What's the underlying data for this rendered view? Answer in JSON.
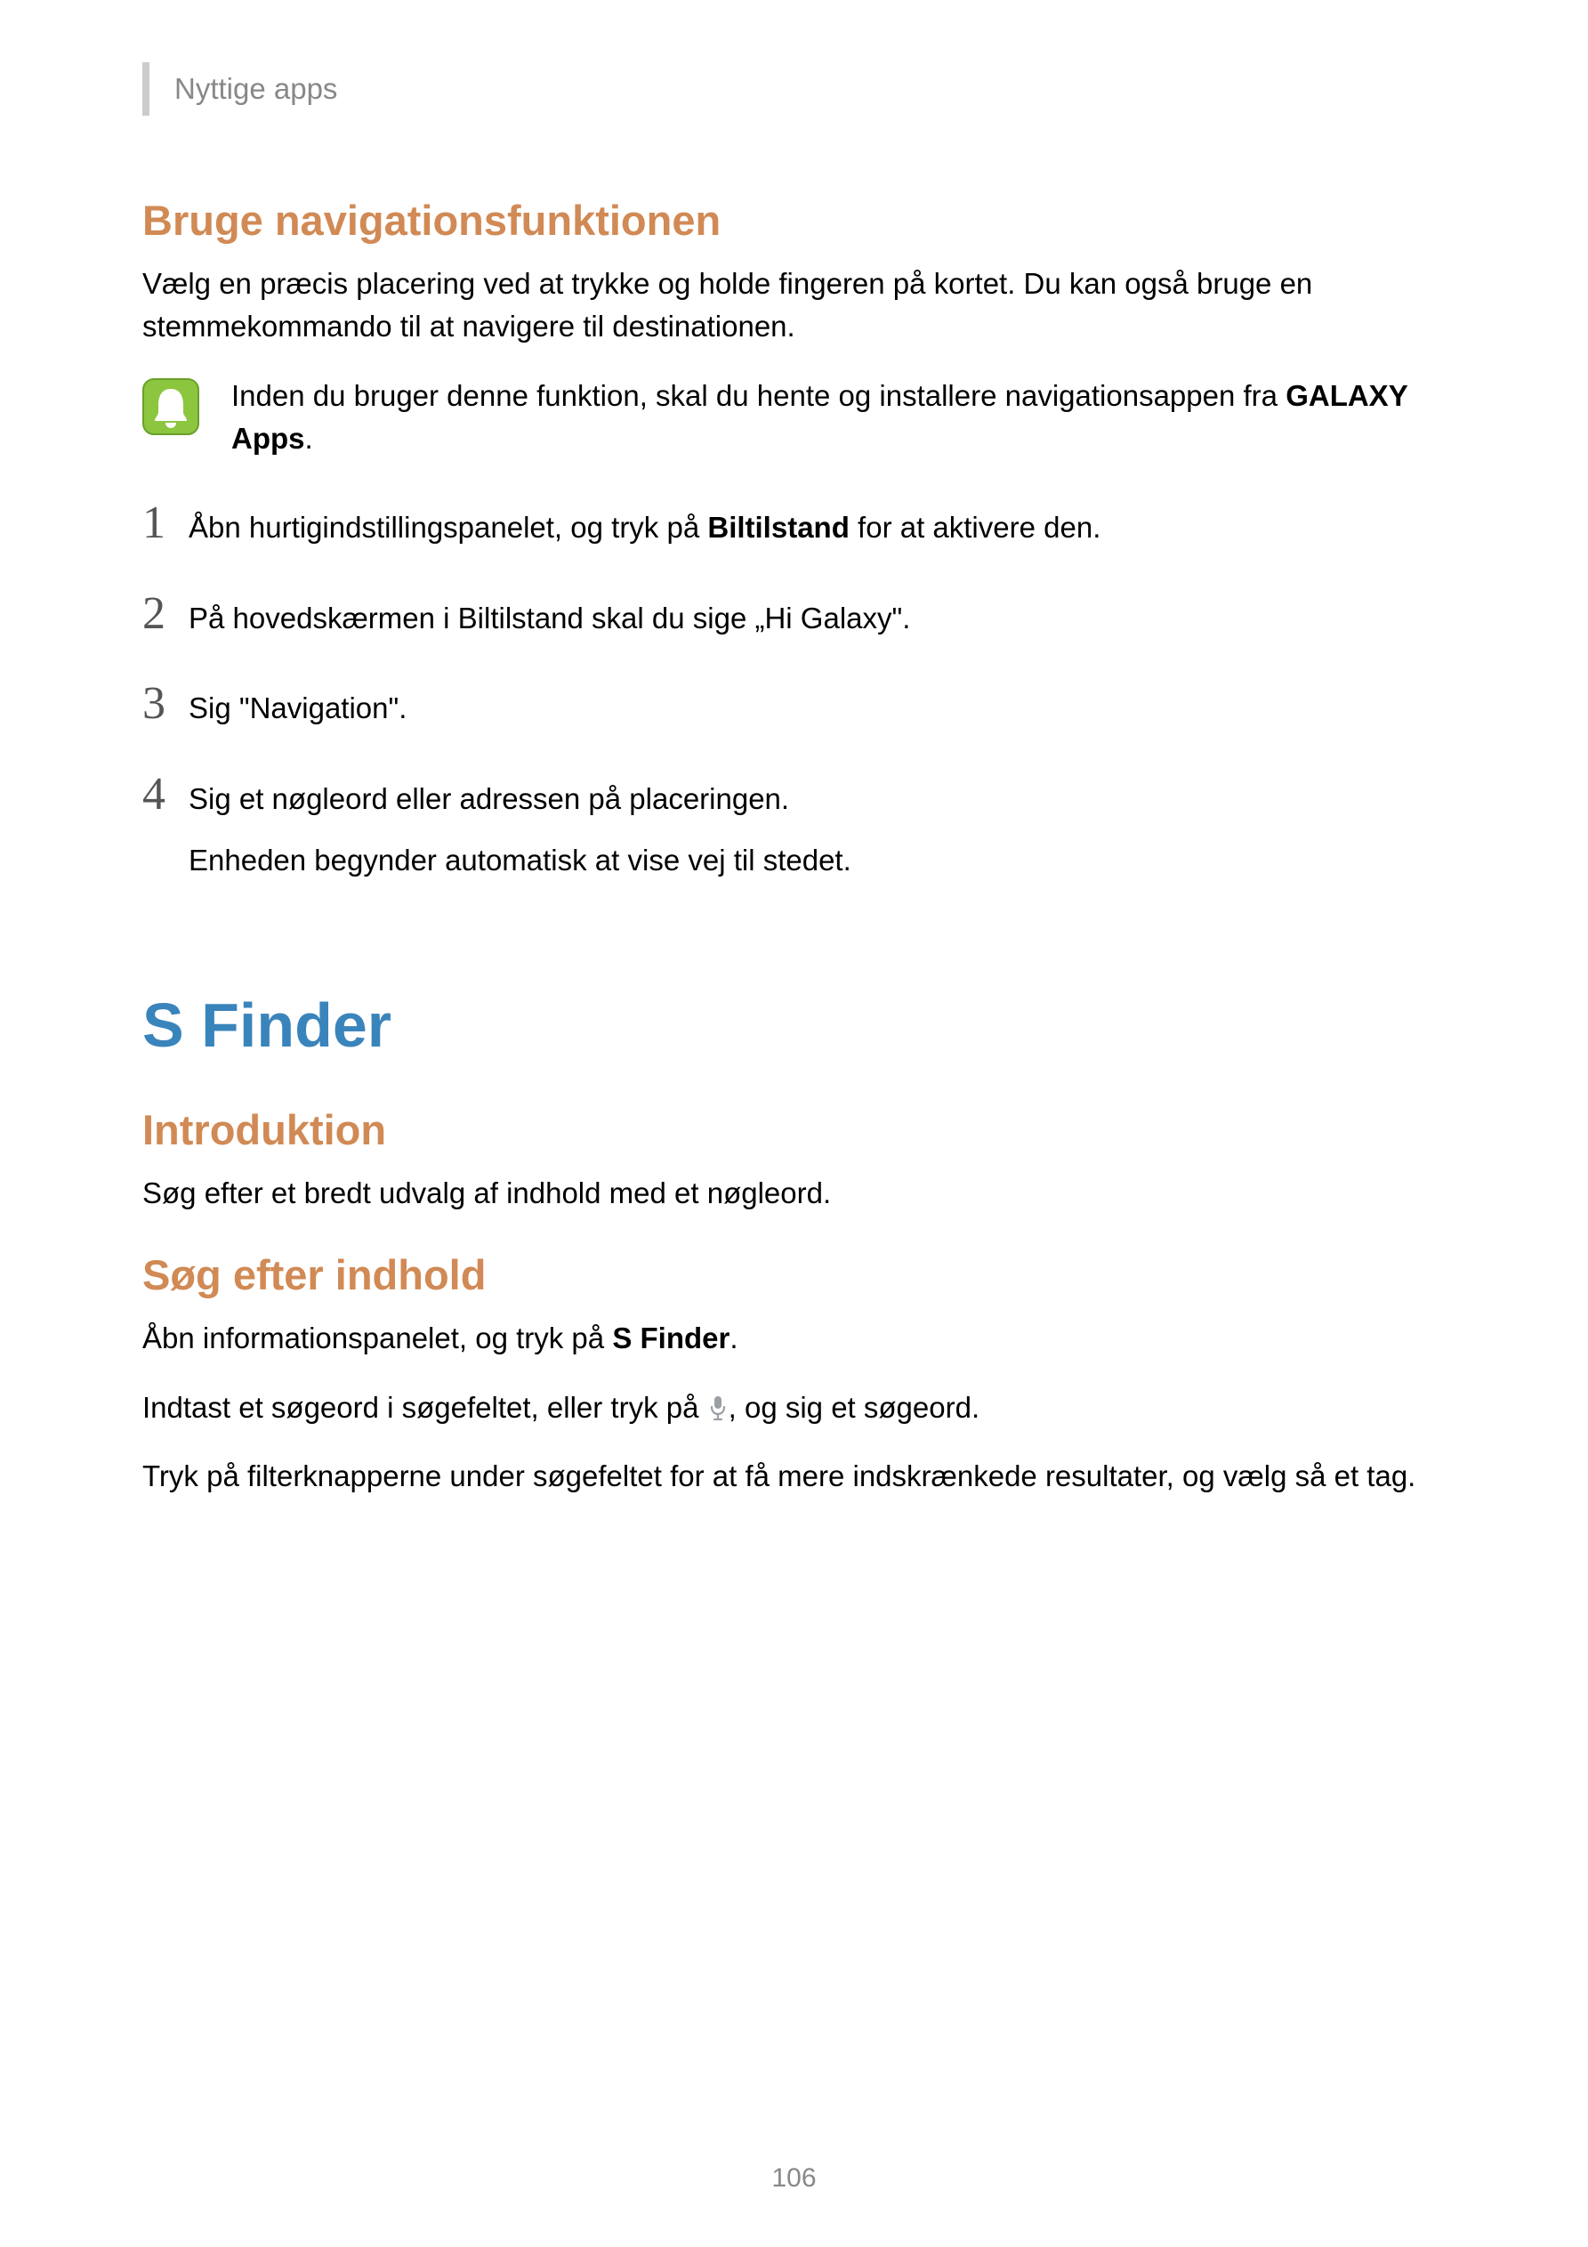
{
  "header": {
    "section": "Nyttige apps"
  },
  "nav": {
    "heading": "Bruge navigationsfunktionen",
    "intro": "Vælg en præcis placering ved at trykke og holde fingeren på kortet. Du kan også bruge en stemmekommando til at navigere til destinationen.",
    "note_pre": "Inden du bruger denne funktion, skal du hente og installere navigationsappen fra ",
    "note_bold": "GALAXY Apps",
    "note_post": ".",
    "steps": [
      {
        "n": "1",
        "pre": "Åbn hurtigindstillingspanelet, og tryk på ",
        "bold": "Biltilstand",
        "post": " for at aktivere den."
      },
      {
        "n": "2",
        "pre": "På hovedskærmen i Biltilstand skal du sige „Hi Galaxy\"."
      },
      {
        "n": "3",
        "pre": "Sig \"Navigation\"."
      },
      {
        "n": "4",
        "pre": "Sig et nøgleord eller adressen på placeringen.",
        "line2": "Enheden begynder automatisk at vise vej til stedet."
      }
    ]
  },
  "sfinder": {
    "title": "S Finder",
    "intro_heading": "Introduktion",
    "intro_text": "Søg efter et bredt udvalg af indhold med et nøgleord.",
    "search_heading": "Søg efter indhold",
    "p1_pre": "Åbn informationspanelet, og tryk på ",
    "p1_bold": "S Finder",
    "p1_post": ".",
    "p2_pre": "Indtast et søgeord i søgefeltet, eller tryk på ",
    "p2_post": ", og sig et søgeord.",
    "p3": "Tryk på filterknapperne under søgefeltet for at få mere indskrænkede resultater, og vælg så et tag."
  },
  "page_number": "106"
}
